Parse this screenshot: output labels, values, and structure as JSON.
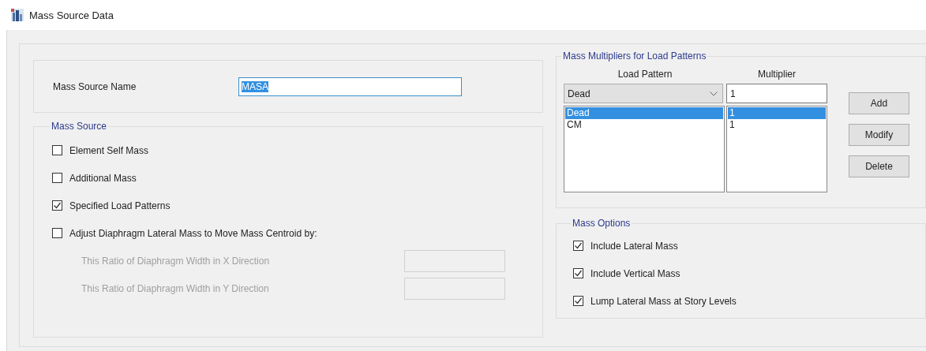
{
  "window": {
    "title": "Mass Source Data"
  },
  "mass_source_name": {
    "label": "Mass Source Name",
    "value": "MASA",
    "selected": true
  },
  "mass_source": {
    "title": "Mass Source",
    "options": [
      {
        "label": "Element Self Mass",
        "checked": false
      },
      {
        "label": "Additional Mass",
        "checked": false
      },
      {
        "label": "Specified Load Patterns",
        "checked": true
      },
      {
        "label": "Adjust Diaphragm Lateral Mass to Move Mass Centroid by:",
        "checked": false
      }
    ],
    "ratio_fields": [
      {
        "label": "This Ratio of Diaphragm Width in X Direction",
        "disabled": true
      },
      {
        "label": "This Ratio of Diaphragm Width in Y Direction",
        "disabled": true
      }
    ]
  },
  "multipliers": {
    "title": "Mass Multipliers for Load Patterns",
    "columns": [
      "Load Pattern",
      "Multiplier"
    ],
    "dropdown": {
      "value": "Dead"
    },
    "multiplier_field": {
      "value": "1"
    },
    "rows": [
      {
        "load_pattern": "Dead",
        "multiplier": "1",
        "selected": true
      },
      {
        "load_pattern": "CM",
        "multiplier": "1",
        "selected": false
      }
    ],
    "buttons": [
      "Add",
      "Modify",
      "Delete"
    ]
  },
  "mass_options": {
    "title": "Mass Options",
    "options": [
      {
        "label": "Include Lateral Mass",
        "checked": true
      },
      {
        "label": "Include Vertical Mass",
        "checked": true
      },
      {
        "label": "Lump Lateral Mass at Story Levels",
        "checked": true
      }
    ]
  }
}
